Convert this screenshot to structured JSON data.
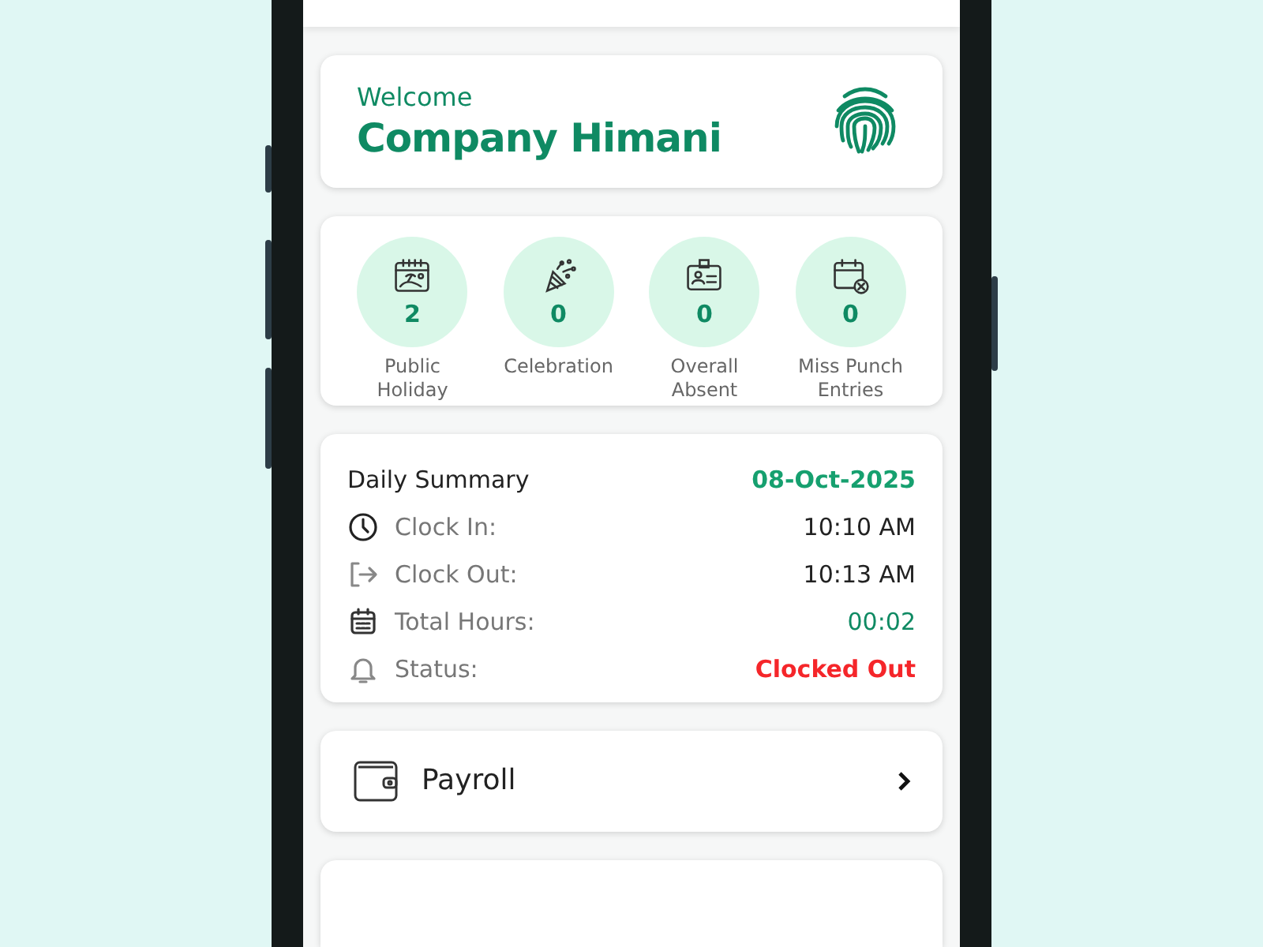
{
  "welcome": {
    "greeting": "Welcome",
    "name": "Company Himani"
  },
  "stats": [
    {
      "count": "2",
      "label": "Public Holiday"
    },
    {
      "count": "0",
      "label": "Celebration"
    },
    {
      "count": "0",
      "label": "Overall Absent"
    },
    {
      "count": "0",
      "label": "Miss Punch Entries"
    }
  ],
  "daily_summary": {
    "title": "Daily Summary",
    "date": "08-Oct-2025",
    "rows": [
      {
        "label": "Clock In:",
        "value": "10:10 AM",
        "kind": "time"
      },
      {
        "label": "Clock Out:",
        "value": "10:13 AM",
        "kind": "time"
      },
      {
        "label": "Total Hours:",
        "value": "00:02",
        "kind": "duration"
      },
      {
        "label": "Status:",
        "value": "Clocked Out",
        "kind": "status"
      }
    ]
  },
  "menu": [
    {
      "label": "Payroll"
    }
  ]
}
